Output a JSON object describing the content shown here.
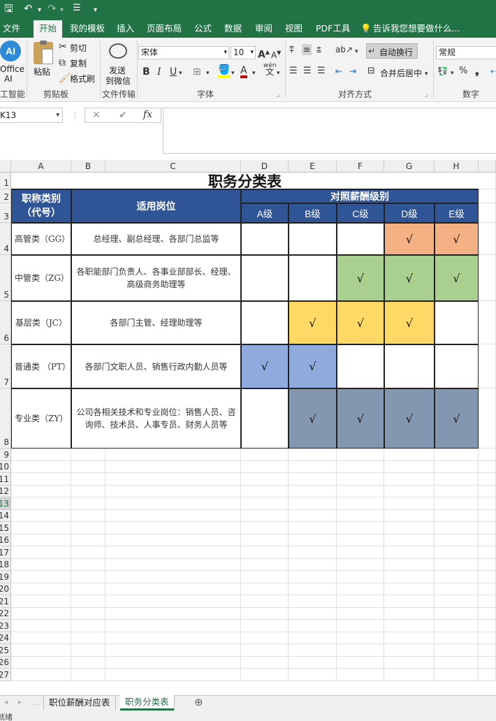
{
  "qat": {
    "save": "🖫",
    "undo": "↶",
    "redo": "↷",
    "more": "▾"
  },
  "tabs": [
    "文件",
    "开始",
    "我的模板",
    "插入",
    "页面布局",
    "公式",
    "数据",
    "审阅",
    "视图",
    "PDF工具"
  ],
  "tell_me": "告诉我您想要做什么...",
  "ribbon": {
    "ai_label_1": "Office",
    "ai_label_2": "AI",
    "ai_group": "工智能",
    "paste": "粘贴",
    "cut": "剪切",
    "copy": "复制",
    "format_painter": "格式刷",
    "clipboard_group": "剪贴板",
    "send_1": "发送",
    "send_2": "到微信",
    "transfer_group": "文件传输",
    "font_name": "宋体",
    "font_size": "10",
    "bold": "B",
    "italic": "I",
    "underline": "U",
    "font_group": "字体",
    "wrap_text": "自动换行",
    "merge_center": "合并后居中",
    "align_group": "对齐方式",
    "number_format": "常规",
    "percent": "%",
    "comma": "❟",
    "number_group": "数字"
  },
  "formula_bar": {
    "name_box": "K13",
    "cancel": "✕",
    "enter": "✔",
    "fx": "fx",
    "content": ""
  },
  "columns": [
    "A",
    "B",
    "C",
    "D",
    "E",
    "F",
    "G",
    "H"
  ],
  "rows": [
    "1",
    "2",
    "3",
    "4",
    "5",
    "6",
    "7",
    "8",
    "9",
    "10",
    "11",
    "12",
    "13",
    "14",
    "15",
    "16",
    "17",
    "18",
    "19",
    "20",
    "21",
    "22",
    "23",
    "24",
    "25",
    "26",
    "27"
  ],
  "table": {
    "title": "职务分类表",
    "col_category": "职称类别（代号）",
    "col_positions": "适用岗位",
    "col_salary": "对照薪酬级别",
    "levels": [
      "A级",
      "B级",
      "C级",
      "D级",
      "E级"
    ],
    "check_mark": "√",
    "rows": [
      {
        "category": "高管类（GG）",
        "positions": "总经理、副总经理、各部门总监等",
        "checks": [
          false,
          false,
          false,
          true,
          true
        ],
        "color": "#f4b183"
      },
      {
        "category": "中管类（ZG）",
        "positions": "各职能部门负责人、各事业部部长、经理、高级商务助理等",
        "checks": [
          false,
          false,
          true,
          true,
          true
        ],
        "color": "#a9d08e"
      },
      {
        "category": "基层类（JC）",
        "positions": "各部门主管、经理助理等",
        "checks": [
          false,
          true,
          true,
          true,
          false
        ],
        "color": "#ffd966"
      },
      {
        "category": "普通类 （PT）",
        "positions": "各部门文职人员、销售行政内勤人员等",
        "checks": [
          true,
          true,
          false,
          false,
          false
        ],
        "color": "#8faadc"
      },
      {
        "category": "专业类（ZY）",
        "positions": "公司各相关技术和专业岗位：销售人员、咨询师、技术员、人事专员、财务人员等",
        "checks": [
          false,
          true,
          true,
          true,
          true
        ],
        "color": "#8497b0"
      }
    ]
  },
  "sheets": [
    "职位薪酬对应表",
    "职务分类表"
  ],
  "active_sheet": 1,
  "add_sheet": "⊕",
  "status_text": "就绪"
}
